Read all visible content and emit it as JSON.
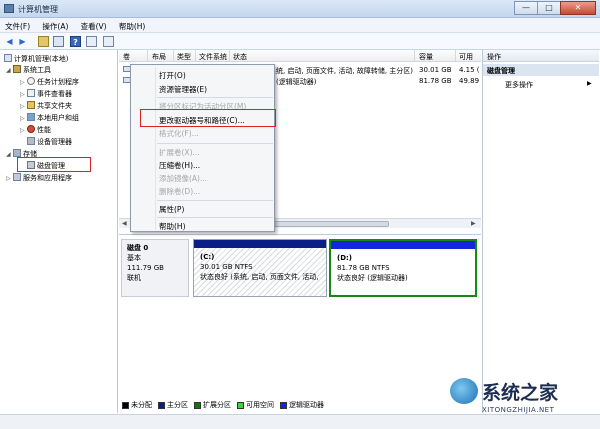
{
  "window": {
    "title": "计算机管理",
    "min": "—",
    "max": "□",
    "close": "✕"
  },
  "menubar": [
    "文件(F)",
    "操作(A)",
    "查看(V)",
    "帮助(H)"
  ],
  "toolbar": {
    "back": "◀",
    "forward": "▶",
    "help": "?"
  },
  "tree": {
    "root": "计算机管理(本地)",
    "system_tools": "系统工具",
    "task_scheduler": "任务计划程序",
    "event_viewer": "事件查看器",
    "shared_folders": "共享文件夹",
    "local_users": "本地用户和组",
    "performance": "性能",
    "device_manager": "设备管理器",
    "storage": "存储",
    "disk_management": "磁盘管理",
    "services": "服务和应用程序"
  },
  "grid": {
    "headers": [
      "卷",
      "布局",
      "类型",
      "文件系统",
      "状态",
      "容量",
      "可用"
    ],
    "rows": [
      {
        "status": "(系统, 启动, 页面文件, 活动, 故障转储, 主分区)",
        "capacity": "30.01 GB",
        "free": "4.15 ("
      },
      {
        "status": "(逻辑驱动器)",
        "capacity": "81.78 GB",
        "free": "49.89"
      }
    ]
  },
  "context_menu": {
    "open": "打开(O)",
    "explore": "资源管理器(E)",
    "mark_active": "将分区标记为活动分区(M)",
    "change_letter": "更改驱动器号和路径(C)...",
    "format": "格式化(F)...",
    "extend": "扩展卷(X)...",
    "shrink": "压缩卷(H)...",
    "add_mirror": "添加镜像(A)...",
    "delete": "删除卷(D)...",
    "properties": "属性(P)",
    "help": "帮助(H)"
  },
  "disk": {
    "name": "磁盘 0",
    "type": "基本",
    "size": "111.79 GB",
    "state": "联机",
    "c": {
      "label": "(C:)",
      "size": "30.01 GB NTFS",
      "status": "状态良好 (系统, 启动, 页面文件, 活动, 故障转储, 主分区)"
    },
    "d": {
      "label": "(D:)",
      "size": "81.78 GB NTFS",
      "status": "状态良好 (逻辑驱动器)"
    }
  },
  "legend": [
    {
      "label": "未分配",
      "color": "#000000"
    },
    {
      "label": "主分区",
      "color": "#0a1e86"
    },
    {
      "label": "扩展分区",
      "color": "#0a7a0a"
    },
    {
      "label": "可用空间",
      "color": "#3cd43c"
    },
    {
      "label": "逻辑驱动器",
      "color": "#1226e0"
    }
  ],
  "actions": {
    "header": "操作",
    "section": "磁盘管理",
    "more": "更多操作",
    "arrow": "▶"
  },
  "watermark": {
    "text": "系统之家",
    "url": "XITONGZHIJIA.NET"
  }
}
